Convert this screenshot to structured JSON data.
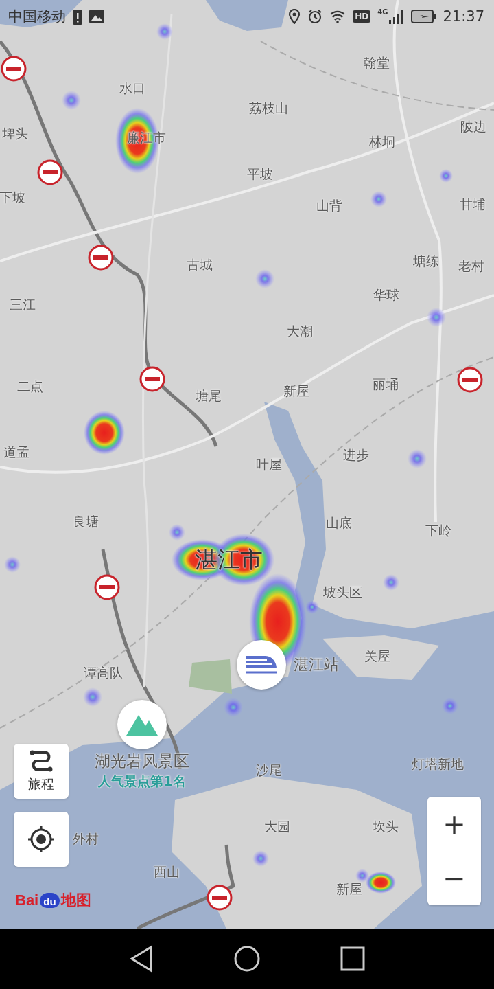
{
  "status_bar": {
    "carrier": "中国移动",
    "hd": "HD",
    "network": "4G",
    "time": "21:37"
  },
  "map": {
    "labels": [
      {
        "text": "翰堂",
        "kind": "place"
      },
      {
        "text": "水口",
        "kind": "place"
      },
      {
        "text": "荔枝山",
        "kind": "place"
      },
      {
        "text": "埤头",
        "kind": "place"
      },
      {
        "text": "廉江市",
        "kind": "place"
      },
      {
        "text": "陂边",
        "kind": "place"
      },
      {
        "text": "林垌",
        "kind": "place"
      },
      {
        "text": "平坡",
        "kind": "place"
      },
      {
        "text": "下坡",
        "kind": "place"
      },
      {
        "text": "甘埔",
        "kind": "place"
      },
      {
        "text": "山背",
        "kind": "place"
      },
      {
        "text": "古城",
        "kind": "place"
      },
      {
        "text": "塘练",
        "kind": "place"
      },
      {
        "text": "老村",
        "kind": "place"
      },
      {
        "text": "三江",
        "kind": "place"
      },
      {
        "text": "华球",
        "kind": "place"
      },
      {
        "text": "大潮",
        "kind": "place"
      },
      {
        "text": "二点",
        "kind": "place"
      },
      {
        "text": "丽埇",
        "kind": "place"
      },
      {
        "text": "塘尾",
        "kind": "place"
      },
      {
        "text": "新屋",
        "kind": "place"
      },
      {
        "text": "道孟",
        "kind": "place"
      },
      {
        "text": "进步",
        "kind": "place"
      },
      {
        "text": "叶屋",
        "kind": "place"
      },
      {
        "text": "良塘",
        "kind": "place"
      },
      {
        "text": "山底",
        "kind": "place"
      },
      {
        "text": "下岭",
        "kind": "place"
      },
      {
        "text": "湛江市",
        "kind": "city"
      },
      {
        "text": "坡头区",
        "kind": "place"
      },
      {
        "text": "关屋",
        "kind": "place"
      },
      {
        "text": "湛江站",
        "kind": "station"
      },
      {
        "text": "谭高队",
        "kind": "place"
      },
      {
        "text": "湖光岩风景区",
        "kind": "scenic"
      },
      {
        "text": "人气景点第1名",
        "kind": "rank"
      },
      {
        "text": "沙尾",
        "kind": "place"
      },
      {
        "text": "灯塔新地",
        "kind": "place"
      },
      {
        "text": "大园",
        "kind": "place"
      },
      {
        "text": "坎头",
        "kind": "place"
      },
      {
        "text": "外村",
        "kind": "place"
      },
      {
        "text": "西山",
        "kind": "place"
      },
      {
        "text": "新屋",
        "kind": "place"
      }
    ]
  },
  "trip_button": {
    "label": "旅程"
  },
  "zoom": {
    "zoom_in": "+",
    "zoom_out": "−"
  },
  "logo": {
    "part_1": "Bai",
    "part_2": "du",
    "part_3": "地图"
  }
}
